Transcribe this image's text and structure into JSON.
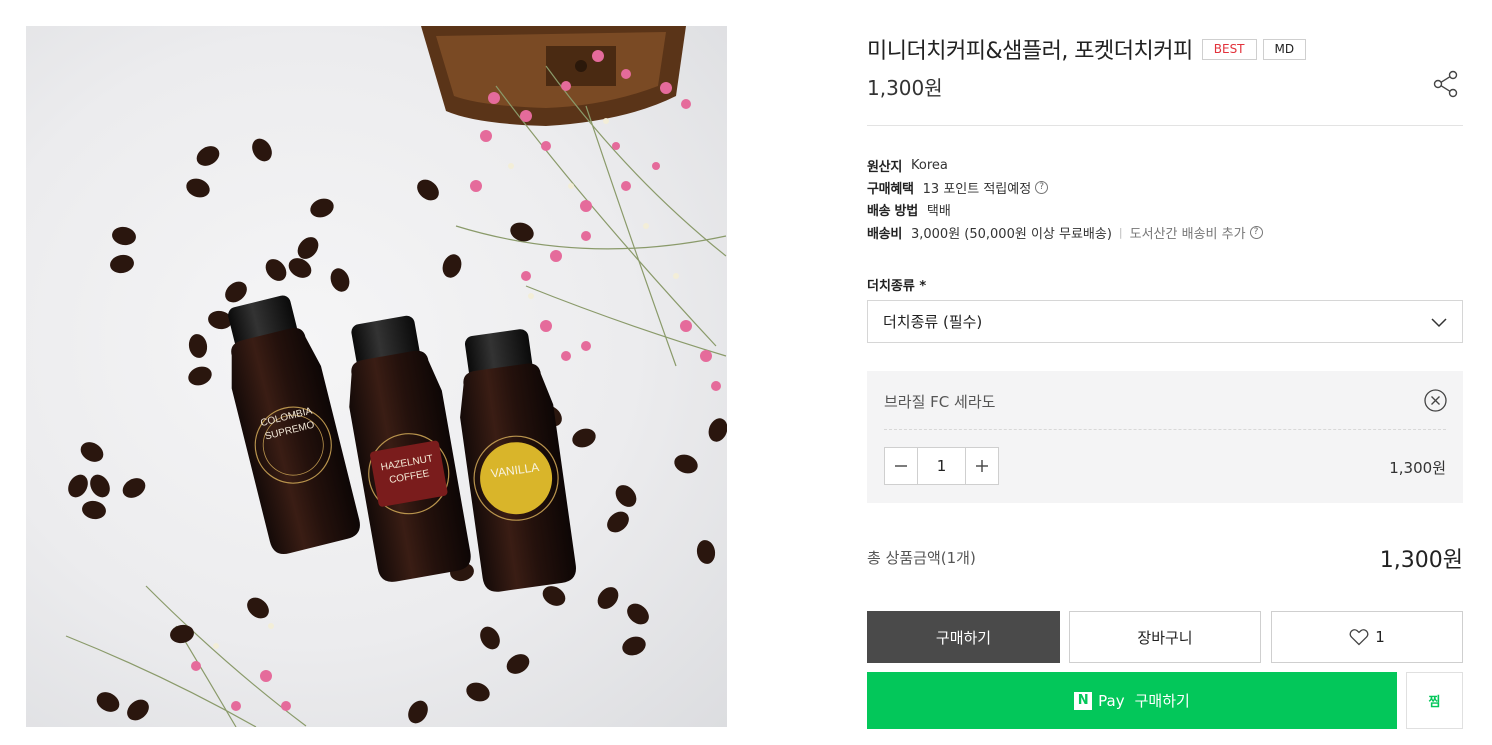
{
  "product": {
    "image_alt": "",
    "title": "미니더치커피&샘플러, 포켓더치커피",
    "badges": {
      "best": "BEST",
      "md": "MD"
    },
    "price": "1,300원",
    "share_icon": "share-icon",
    "label_texts": {
      "bottle1_line1": "COLOMBIA",
      "bottle1_line2": "SUPREMO",
      "bottle2_line1": "HAZELNUT",
      "bottle2_line2": "COFFEE",
      "bottle3_line1": "VANILLA"
    }
  },
  "info": {
    "origin_label": "원산지",
    "origin_value": "Korea",
    "benefit_label": "구매혜택",
    "benefit_value": "13 포인트 적립예정",
    "method_label": "배송 방법",
    "method_value": "택배",
    "fee_label": "배송비",
    "fee_value": "3,000원 (50,000원 이상 무료배송)",
    "fee_separator": "|",
    "island_fee": "도서산간 배송비 추가",
    "help_glyph": "?"
  },
  "option": {
    "label": "더치종류 *",
    "select_placeholder": "더치종류 (필수)",
    "selected_name": "브라질 FC 세라도",
    "quantity": "1",
    "selected_price": "1,300원"
  },
  "total": {
    "label": "총 상품금액(1개)",
    "price": "1,300원"
  },
  "actions": {
    "buy": "구매하기",
    "cart": "장바구니",
    "like_count": "1",
    "npay_logo": "N",
    "npay_pay": "Pay",
    "npay_buy": "구매하기",
    "zzim": "찜"
  },
  "colors": {
    "best_badge": "#e2323b",
    "buy_button": "#4a4a4a",
    "npay_green": "#03c75a"
  }
}
